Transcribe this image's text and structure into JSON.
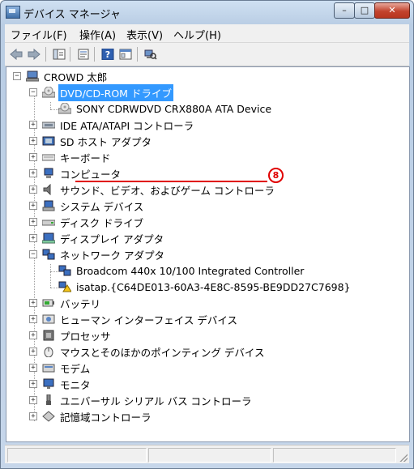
{
  "window": {
    "title": "デバイス マネージャ",
    "controls": {
      "minimize": "–",
      "maximize": "□",
      "close": "✕"
    }
  },
  "menu": {
    "file": "ファイル(F)",
    "action": "操作(A)",
    "view": "表示(V)",
    "help": "ヘルプ(H)"
  },
  "toolbar": {
    "icons": [
      "back-arrow-icon",
      "forward-arrow-icon",
      "show-hide-tree-icon",
      "properties-icon",
      "help-icon",
      "view-icon",
      "scan-hardware-icon"
    ]
  },
  "tree": {
    "root": "CROWD 太郎",
    "nodes": [
      {
        "label": "DVD/CD-ROM ドライブ",
        "icon": "dvd-drive-icon",
        "expanded": true,
        "selected": true,
        "children": [
          {
            "label": "SONY CDRWDVD CRX880A ATA Device",
            "icon": "dvd-drive-icon"
          }
        ]
      },
      {
        "label": "IDE ATA/ATAPI コントローラ",
        "icon": "ide-controller-icon"
      },
      {
        "label": "SD ホスト アダプタ",
        "icon": "sd-host-icon"
      },
      {
        "label": "キーボード",
        "icon": "keyboard-icon"
      },
      {
        "label": "コンピュータ",
        "icon": "computer-icon"
      },
      {
        "label": "サウンド、ビデオ、およびゲーム コントローラ",
        "icon": "speaker-icon"
      },
      {
        "label": "システム デバイス",
        "icon": "system-device-icon"
      },
      {
        "label": "ディスク ドライブ",
        "icon": "disk-drive-icon"
      },
      {
        "label": "ディスプレイ アダプタ",
        "icon": "display-adapter-icon"
      },
      {
        "label": "ネットワーク アダプタ",
        "icon": "network-adapter-icon",
        "expanded": true,
        "children": [
          {
            "label": "Broadcom 440x 10/100 Integrated Controller",
            "icon": "network-adapter-icon"
          },
          {
            "label": "isatap.{C64DE013-60A3-4E8C-8595-BE9DD27C7698}",
            "icon": "network-warning-icon"
          }
        ]
      },
      {
        "label": "バッテリ",
        "icon": "battery-icon"
      },
      {
        "label": "ヒューマン インターフェイス デバイス",
        "icon": "hid-icon"
      },
      {
        "label": "プロセッサ",
        "icon": "processor-icon"
      },
      {
        "label": "マウスとそのほかのポインティング デバイス",
        "icon": "mouse-icon"
      },
      {
        "label": "モデム",
        "icon": "modem-icon"
      },
      {
        "label": "モニタ",
        "icon": "monitor-icon"
      },
      {
        "label": "ユニバーサル シリアル バス コントローラ",
        "icon": "usb-icon"
      },
      {
        "label": "記憶域コントローラ",
        "icon": "storage-controller-icon"
      }
    ]
  },
  "annotation": {
    "marker": "8"
  },
  "colors": {
    "selection": "#3399ff",
    "annotation": "#e00000",
    "close_button": "#c2432d"
  }
}
